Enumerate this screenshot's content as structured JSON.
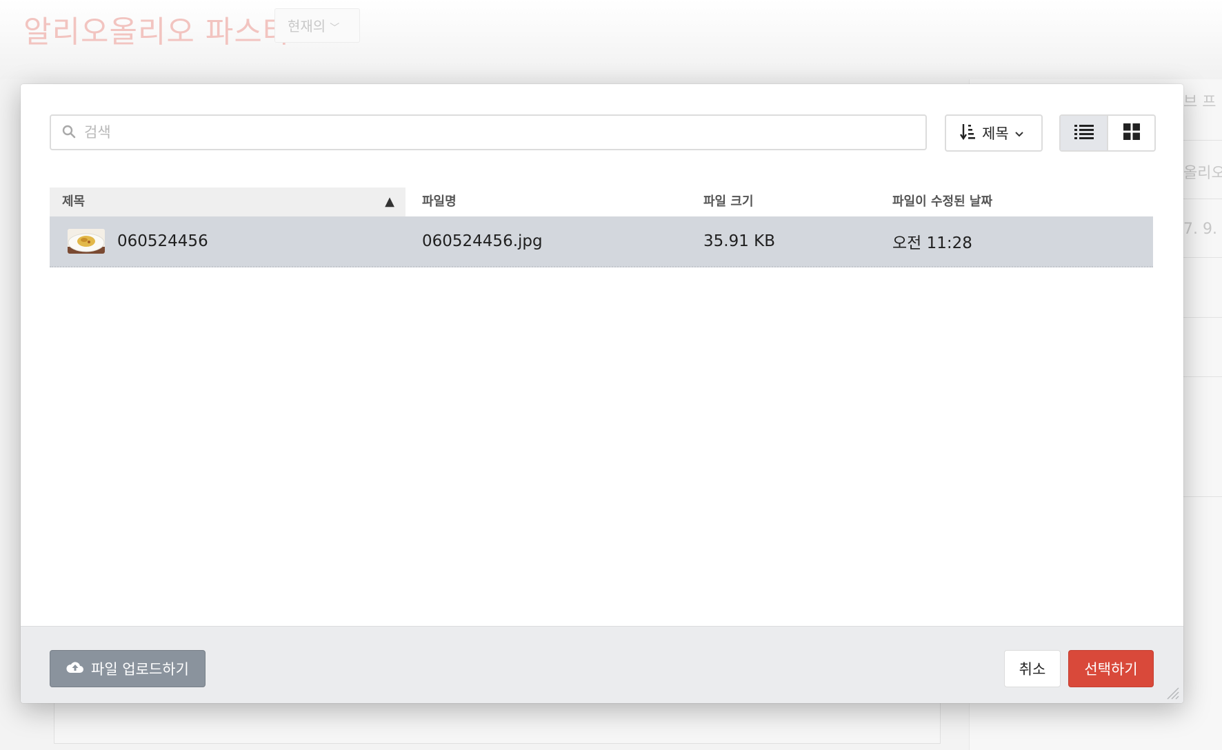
{
  "background": {
    "page_title": "알리오올리오 파스타",
    "dropdown_label": "현재의",
    "right_texts": [
      "브 프",
      "올리오",
      "7. 9."
    ]
  },
  "search": {
    "placeholder": "검색",
    "value": ""
  },
  "sort": {
    "label": "제목"
  },
  "view": {
    "active": "list"
  },
  "table": {
    "columns": [
      "제목",
      "파일명",
      "파일 크기",
      "파일이 수정된 날짜"
    ],
    "sorted_column": "제목",
    "sort_direction": "ascending",
    "rows": [
      {
        "title": "060524456",
        "filename": "060524456.jpg",
        "size": "35.91 KB",
        "modified": "오전 11:28",
        "selected": true
      }
    ]
  },
  "footer": {
    "upload_label": "파일 업로드하기",
    "cancel_label": "취소",
    "select_label": "선택하기"
  },
  "colors": {
    "primary_action": "#d9493a",
    "upload_button": "#8a939d",
    "selected_row": "#d3d7dd"
  },
  "icons": {
    "search": "search-icon",
    "sort": "sort-amount-icon",
    "list_view": "list-icon",
    "grid_view": "grid-icon",
    "upload": "cloud-upload-icon"
  }
}
